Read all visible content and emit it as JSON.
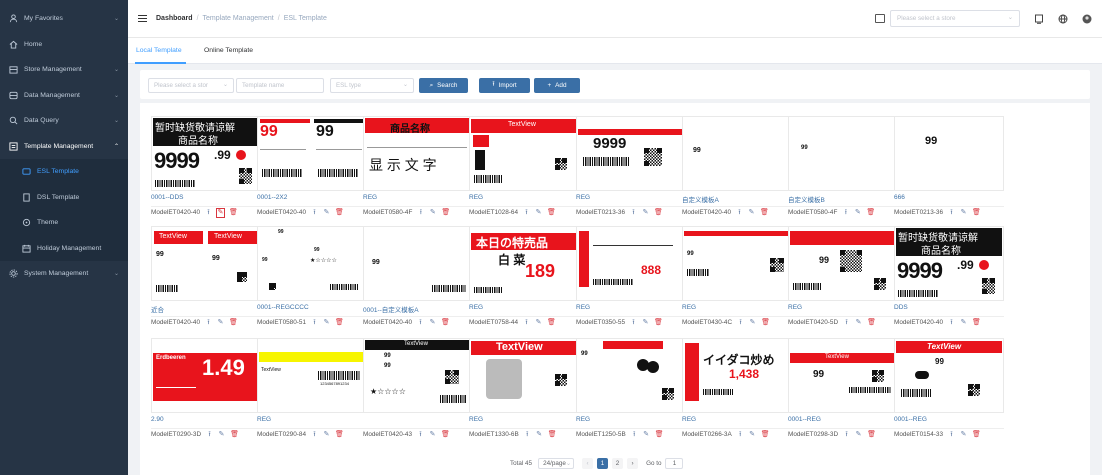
{
  "sidebar": {
    "items": [
      {
        "label": "My Favorites",
        "icon": "user-icon"
      },
      {
        "label": "Home",
        "icon": "home-icon"
      },
      {
        "label": "Store Management",
        "icon": "store-icon"
      },
      {
        "label": "Data Management",
        "icon": "database-icon"
      },
      {
        "label": "Data Query",
        "icon": "search-icon"
      },
      {
        "label": "Template Management",
        "icon": "template-icon"
      },
      {
        "label": "ESL Template",
        "icon": "esl-icon"
      },
      {
        "label": "DSL Template",
        "icon": "dsl-icon"
      },
      {
        "label": "Theme",
        "icon": "theme-icon"
      },
      {
        "label": "Holiday Management",
        "icon": "calendar-icon"
      },
      {
        "label": "System Management",
        "icon": "gear-icon"
      }
    ]
  },
  "header": {
    "breadcrumb": [
      "Dashboard",
      "Template Management",
      "ESL Template"
    ],
    "store_placeholder": "Please select a store"
  },
  "tabs": [
    "Local Template",
    "Online Template"
  ],
  "filter": {
    "store_placeholder": "Please select a stor",
    "name_placeholder": "Template name",
    "type_placeholder": "ESL type",
    "search_label": "Search",
    "import_label": "Import",
    "add_label": "Add"
  },
  "cards": [
    {
      "name": "0001--DDS",
      "model": "ModelET0420-40"
    },
    {
      "name": "0001--2X2",
      "model": "ModelET0420-40"
    },
    {
      "name": "REG",
      "model": "ModelET0580-4F"
    },
    {
      "name": "REG",
      "model": "ModelET1028-64"
    },
    {
      "name": "REG",
      "model": "ModelET0213-36"
    },
    {
      "name": "自定义模板A",
      "model": "ModelET0420-40"
    },
    {
      "name": "自定义模板B",
      "model": "ModelET0580-4F"
    },
    {
      "name": "666",
      "model": "ModelET0213-36"
    },
    {
      "name": "近合",
      "model": "ModelET0420-40"
    },
    {
      "name": "0001--REGCCCC",
      "model": "ModelET0580-51"
    },
    {
      "name": "0001--自定义模板A",
      "model": "ModelET0420-40"
    },
    {
      "name": "REG",
      "model": "ModelET0758-44"
    },
    {
      "name": "REG",
      "model": "ModelET0350-55"
    },
    {
      "name": "REG",
      "model": "ModelET0430-4C"
    },
    {
      "name": "REG",
      "model": "ModelET0420-5D"
    },
    {
      "name": "DDS",
      "model": "ModelET0420-40"
    },
    {
      "name": "2.90",
      "model": "ModelET0290-3D"
    },
    {
      "name": "REG",
      "model": "ModelET0290-84"
    },
    {
      "name": "",
      "model": "ModelET0420-43"
    },
    {
      "name": "REG",
      "model": "ModelET1330-6B"
    },
    {
      "name": "REG",
      "model": "ModelET1250-5B"
    },
    {
      "name": "REG",
      "model": "ModelET0266-3A"
    },
    {
      "name": "0001--REG",
      "model": "ModelET0298-3D"
    },
    {
      "name": "0001--REG",
      "model": "ModelET0154-33"
    }
  ],
  "thumb_text": {
    "cn_notice": "暂时缺货敬请谅解",
    "cn_product": "商品名称",
    "cn_display": "显 示 文 字",
    "price_9999": "9999",
    "cents_99": ".99",
    "price_99": "99",
    "textview": "TextView",
    "jp_today": "本日の特売品",
    "jp_hakusai": "白 菜",
    "price_189": "189",
    "price_888": "888",
    "jp_ad": "広告の品",
    "jp_ika": "イイダコ炒め",
    "price_1438": "1,438",
    "price_149": "1.49",
    "erdbeeren": "Erdbeeren",
    "stars": "★☆☆☆☆",
    "barcode_num": "1234567891234"
  },
  "pagination": {
    "total": "Total 45",
    "page_size": "24/page",
    "pages": [
      "1",
      "2"
    ],
    "current": "1",
    "goto_label": "Go to",
    "goto_value": "1"
  }
}
